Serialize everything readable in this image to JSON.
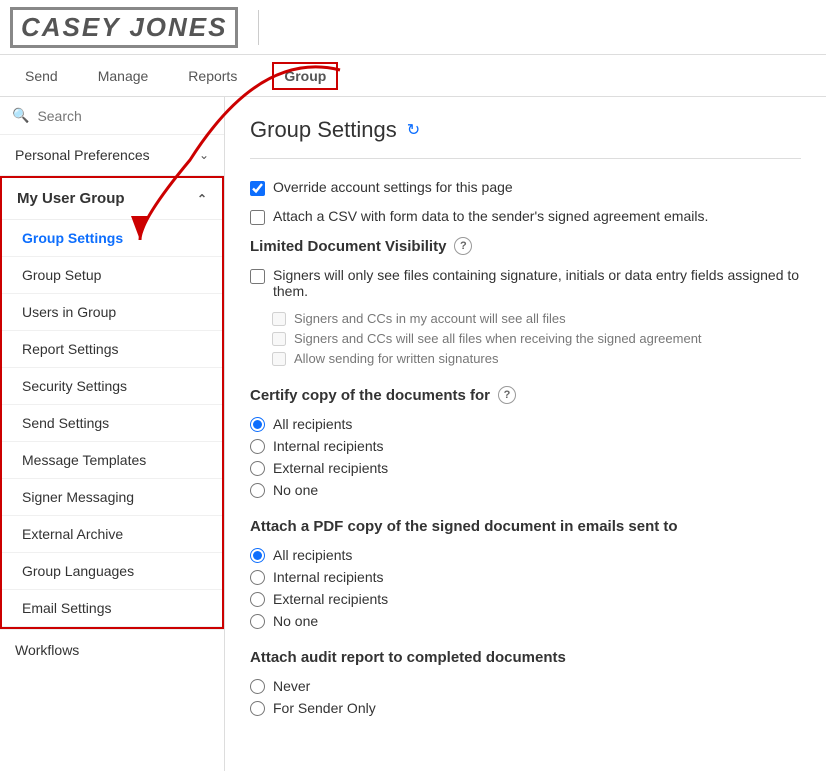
{
  "header": {
    "logo": "CASEY JONES",
    "nav_items": [
      "Send",
      "Manage",
      "Reports",
      "Group"
    ]
  },
  "sidebar": {
    "search_placeholder": "Search",
    "personal_preferences_label": "Personal Preferences",
    "my_user_group_label": "My User Group",
    "menu_items": [
      {
        "label": "Group Settings",
        "active": true
      },
      {
        "label": "Group Setup",
        "active": false
      },
      {
        "label": "Users in Group",
        "active": false
      },
      {
        "label": "Report Settings",
        "active": false
      },
      {
        "label": "Security Settings",
        "active": false
      },
      {
        "label": "Send Settings",
        "active": false
      },
      {
        "label": "Message Templates",
        "active": false
      },
      {
        "label": "Signer Messaging",
        "active": false
      },
      {
        "label": "External Archive",
        "active": false
      },
      {
        "label": "Group Languages",
        "active": false
      },
      {
        "label": "Email Settings",
        "active": false
      }
    ],
    "bottom_item": "Workflows"
  },
  "main": {
    "page_title": "Group Settings",
    "settings": {
      "override_label": "Override account settings for this page",
      "attach_csv_label": "Attach a CSV with form data to the sender's signed agreement emails.",
      "limited_doc_visibility_heading": "Limited Document Visibility",
      "limited_doc_visibility_help": "?",
      "signers_only_label": "Signers will only see files containing signature, initials or data entry fields assigned to them.",
      "sub_checkbox_1": "Signers and CCs in my account will see all files",
      "sub_checkbox_2": "Signers and CCs will see all files when receiving the signed agreement",
      "sub_checkbox_3": "Allow sending for written signatures",
      "certify_copy_heading": "Certify copy of the documents for",
      "certify_copy_help": "?",
      "certify_options": [
        "All recipients",
        "Internal recipients",
        "External recipients",
        "No one"
      ],
      "certify_selected": "All recipients",
      "attach_pdf_heading": "Attach a PDF copy of the signed document in emails sent to",
      "attach_pdf_options": [
        "All recipients",
        "Internal recipients",
        "External recipients",
        "No one"
      ],
      "attach_pdf_selected": "All recipients",
      "audit_report_heading": "Attach audit report to completed documents",
      "audit_options": [
        "Never",
        "For Sender Only"
      ],
      "audit_selected": ""
    }
  }
}
